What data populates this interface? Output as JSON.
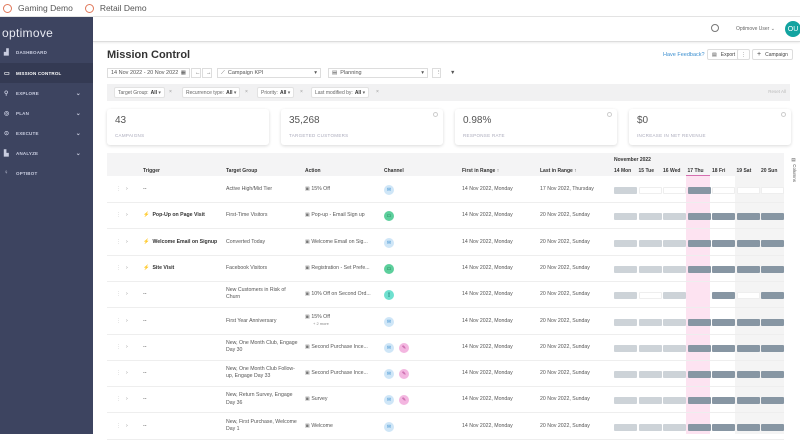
{
  "browser_tabs": [
    {
      "label": "Gaming Demo"
    },
    {
      "label": "Retail Demo"
    }
  ],
  "sidebar": {
    "logo": "optimove",
    "items": [
      {
        "label": "DASHBOARD",
        "icon": "dashboard-icon",
        "glyph": "▟",
        "chevron": false
      },
      {
        "label": "MISSION CONTROL",
        "icon": "monitor-icon",
        "glyph": "▭",
        "chevron": false,
        "active": true
      },
      {
        "label": "EXPLORE",
        "icon": "explore-icon",
        "glyph": "⚲",
        "chevron": true
      },
      {
        "label": "PLAN",
        "icon": "plan-icon",
        "glyph": "◎",
        "chevron": true
      },
      {
        "label": "EXECUTE",
        "icon": "execute-icon",
        "glyph": "⊙",
        "chevron": true
      },
      {
        "label": "ANALYZE",
        "icon": "analyze-icon",
        "glyph": "▙",
        "chevron": true
      },
      {
        "label": "OPTIBOT",
        "icon": "bot-icon",
        "glyph": "♀",
        "chevron": false
      }
    ]
  },
  "header": {
    "user": "Optimove User",
    "avatar": "OU"
  },
  "page": {
    "title": "Mission Control",
    "feedback": "Have Feedback?",
    "export": "Export",
    "campaign": "Campaign"
  },
  "toolbar": {
    "date_range": "14 Nov 2022 - 20 Nov 2022",
    "kpi": "Campaign KPI",
    "view": "Planning"
  },
  "filters": [
    {
      "label": "Target Group:",
      "value": "All"
    },
    {
      "label": "Recurrence type:",
      "value": "All"
    },
    {
      "label": "Priority:",
      "value": "All"
    },
    {
      "label": "Last modified by:",
      "value": "All"
    }
  ],
  "reset_all": "Reset All",
  "kpis": [
    {
      "value": "43",
      "label": "CAMPAIGNS"
    },
    {
      "value": "35,268",
      "label": "TARGETED CUSTOMERS"
    },
    {
      "value": "0.98%",
      "label": "RESPONSE RATE"
    },
    {
      "value": "$0",
      "label": "INCREASE IN NET REVENUE"
    }
  ],
  "table": {
    "columns": [
      "Trigger",
      "Target Group",
      "Action",
      "Channel",
      "First in Range",
      "Last in Range"
    ],
    "month": "November 2022",
    "days": [
      "14 Mon",
      "15 Tue",
      "16 Wed",
      "17 Thu",
      "18 Fri",
      "19 Sat",
      "20 Sun"
    ],
    "columns_tab": "Columns",
    "rows": [
      {
        "trigger": "--",
        "starred": false,
        "target": "Active High/Mid Tier",
        "action": "15% Off",
        "channels": [
          "email"
        ],
        "first": "14 Nov 2022, Monday",
        "last": "17 Nov 2022, Thursday",
        "bars": "LWWDWWW"
      },
      {
        "trigger": "Pop-Up on Page Visit",
        "starred": true,
        "target": "First-Time Visitors",
        "action": "Pop-up - Email Sign up",
        "channels": [
          "web"
        ],
        "first": "14 Nov 2022, Monday",
        "last": "20 Nov 2022, Sunday",
        "bars": "LLLDDDD"
      },
      {
        "trigger": "Welcome Email on Signup",
        "starred": true,
        "target": "Converted Today",
        "action": "Welcome Email on Sig...",
        "channels": [
          "email"
        ],
        "first": "14 Nov 2022, Monday",
        "last": "20 Nov 2022, Sunday",
        "bars": "LLLDDDD"
      },
      {
        "trigger": "Site Visit",
        "starred": true,
        "target": "Facebook Visitors",
        "action": "Registration - Set Prefe...",
        "channels": [
          "web"
        ],
        "first": "14 Nov 2022, Monday",
        "last": "20 Nov 2022, Sunday",
        "bars": "LLLDDDD"
      },
      {
        "trigger": "--",
        "starred": false,
        "target": "New Customers in Risk of Churn",
        "action": "10% Off on Second Ord...",
        "channels": [
          "mobile"
        ],
        "first": "14 Nov 2022, Monday",
        "last": "20 Nov 2022, Sunday",
        "bars": "LWL-DWD"
      },
      {
        "trigger": "--",
        "starred": false,
        "target": "First Year Anniversary",
        "action": "15% Off",
        "more": "+ 2 more",
        "channels": [
          "email"
        ],
        "first": "14 Nov 2022, Monday",
        "last": "20 Nov 2022, Sunday",
        "bars": "LLLDDDD"
      },
      {
        "trigger": "--",
        "starred": false,
        "target": "New, One Month Club, Engage Day 30",
        "action": "Second Purchase Ince...",
        "channels": [
          "email",
          "sms"
        ],
        "first": "14 Nov 2022, Monday",
        "last": "20 Nov 2022, Sunday",
        "bars": "LLLDDDD"
      },
      {
        "trigger": "--",
        "starred": false,
        "target": "New, One Month Club Follow-up, Engage Day 33",
        "action": "Second Purchase Ince...",
        "channels": [
          "email",
          "sms"
        ],
        "first": "14 Nov 2022, Monday",
        "last": "20 Nov 2022, Sunday",
        "bars": "LLLDDDD"
      },
      {
        "trigger": "--",
        "starred": false,
        "target": "New, Return Survey, Engage Day 36",
        "action": "Survey",
        "channels": [
          "email",
          "sms"
        ],
        "first": "14 Nov 2022, Monday",
        "last": "20 Nov 2022, Sunday",
        "bars": "LLLDDDD"
      },
      {
        "trigger": "--",
        "starred": false,
        "target": "New, First Purchase, Welcome Day 1",
        "action": "Welcome",
        "channels": [
          "email"
        ],
        "first": "14 Nov 2022, Monday",
        "last": "20 Nov 2022, Sunday",
        "bars": "LLLDDDD"
      }
    ]
  },
  "colors": {
    "sidebar": "#3d4460",
    "accent": "#12a3a0",
    "today": "#fde3f1",
    "bar_light": "#cdd3d8",
    "bar_dark": "#8796a3",
    "email": "#cfe6f7",
    "web": "#5ccf9c",
    "mobile": "#6fe0cf",
    "sms": "#f3b6e0"
  }
}
